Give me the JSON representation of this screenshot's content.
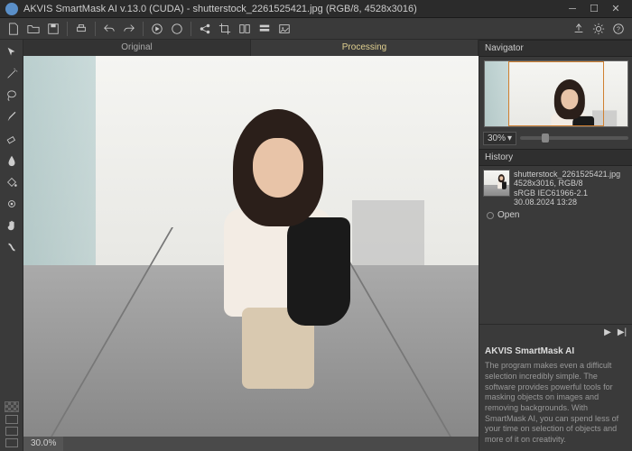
{
  "window": {
    "title": "AKVIS SmartMask AI v.13.0 (CUDA) - shutterstock_2261525421.jpg (RGB/8, 4528x3016)"
  },
  "toolbar": {
    "icons": [
      "new",
      "open",
      "save",
      "print",
      "sep",
      "nav-left",
      "nav-right",
      "sep",
      "zoom-in",
      "zoom-out",
      "sep",
      "share",
      "crop",
      "compare",
      "sep",
      "presets",
      "layers"
    ],
    "right_icons": [
      "prefs",
      "settings-gear",
      "help"
    ]
  },
  "tools": [
    "pointer",
    "wand",
    "lasso",
    "brush",
    "eraser",
    "drop",
    "bucket",
    "refine",
    "hand",
    "smudge"
  ],
  "canvas": {
    "tabs": {
      "original": "Original",
      "processing": "Processing"
    },
    "active_tab": "processing"
  },
  "status": {
    "zoom": "30.0%"
  },
  "navigator": {
    "title": "Navigator",
    "zoom": "30%"
  },
  "history": {
    "title": "History",
    "item": {
      "filename": "shutterstock_2261525421.jpg",
      "dims": "4528x3016, RGB/8",
      "profile": "sRGB IEC61966-2.1",
      "date": "30.08.2024 13:28"
    },
    "open_label": "Open"
  },
  "description": {
    "title": "AKVIS SmartMask AI",
    "body": "The program makes even a difficult selection incredibly simple. The software provides powerful tools for masking objects on images and removing backgrounds. With SmartMask AI, you can spend less of your time on selection of objects and more of it on creativity."
  }
}
